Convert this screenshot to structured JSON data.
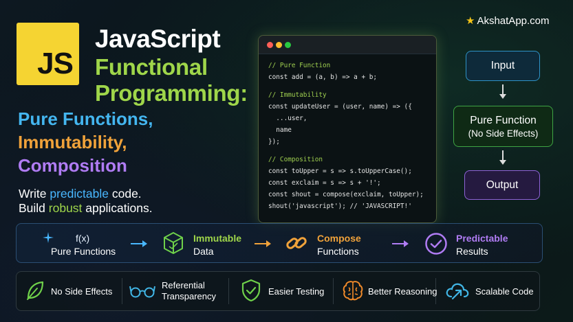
{
  "logo": {
    "text": "JS"
  },
  "title": {
    "line1": "JavaScript",
    "line2": "Functional",
    "line3": "Programming:"
  },
  "topics": [
    "Pure Functions,",
    "Immutability,",
    "Composition"
  ],
  "tagline": {
    "line1_pre": "Write ",
    "line1_highlight": "predictable",
    "line1_post": " code.",
    "line2_pre": "Build ",
    "line2_highlight": "robust",
    "line2_post": " applications."
  },
  "brand": {
    "name": "AkshatApp.com",
    "icon": "star-icon"
  },
  "code": {
    "lines": [
      {
        "text": "// Pure Function",
        "type": "comment"
      },
      {
        "text": "const add = (a, b) => a + b;",
        "type": "code"
      },
      {
        "text": "",
        "type": "gap"
      },
      {
        "text": "// Immutability",
        "type": "comment"
      },
      {
        "text": "const updateUser = (user, name) => ({",
        "type": "code"
      },
      {
        "text": "  ...user,",
        "type": "code"
      },
      {
        "text": "  name",
        "type": "code"
      },
      {
        "text": "});",
        "type": "code"
      },
      {
        "text": "",
        "type": "gap"
      },
      {
        "text": "// Composition",
        "type": "comment"
      },
      {
        "text": "const toUpper = s => s.toUpperCase();",
        "type": "code"
      },
      {
        "text": "const exclaim = s => s + '!';",
        "type": "code"
      },
      {
        "text": "const shout = compose(exclaim, toUpper);",
        "type": "code"
      },
      {
        "text": "shout('javascript'); // 'JAVASCRIPT!'",
        "type": "code"
      }
    ]
  },
  "flow": {
    "input": "Input",
    "pure": "Pure Function",
    "pure_sub": "(No Side Effects)",
    "output": "Output"
  },
  "concepts": {
    "fx_label": "f(x)",
    "pure": "Pure Functions",
    "immutable_title": "Immutable",
    "immutable_sub": "Data",
    "compose_title": "Compose",
    "compose_sub": "Functions",
    "predict_title": "Predictable",
    "predict_sub": "Results"
  },
  "benefits": [
    {
      "icon": "leaf-icon",
      "label": "No Side Effects"
    },
    {
      "icon": "glasses-icon",
      "label": "Referential\nTransparency"
    },
    {
      "icon": "shield-check-icon",
      "label": "Easier Testing"
    },
    {
      "icon": "brain-icon",
      "label": "Better Reasoning"
    },
    {
      "icon": "cloud-arrow-icon",
      "label": "Scalable Code"
    }
  ],
  "colors": {
    "js_yellow": "#f5d432",
    "green": "#9fd64a",
    "blue": "#44b6f0",
    "orange": "#f0a23a",
    "purple": "#b07cf4"
  }
}
